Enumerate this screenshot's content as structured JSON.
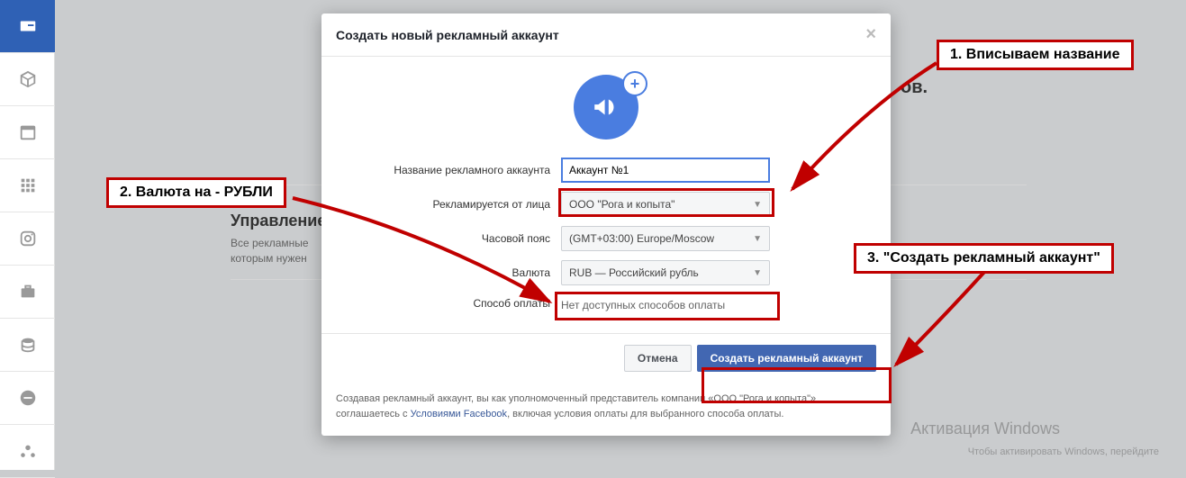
{
  "sidebar": {
    "items": [
      {
        "name": "id-card-icon"
      },
      {
        "name": "cube-icon"
      },
      {
        "name": "calendar-icon"
      },
      {
        "name": "grid-icon"
      },
      {
        "name": "instagram-icon"
      },
      {
        "name": "briefcase-icon"
      },
      {
        "name": "stack-icon"
      },
      {
        "name": "minus-circle-icon"
      },
      {
        "name": "share-icon"
      }
    ]
  },
  "background": {
    "heading_end": "ов.",
    "section_title": "Управление",
    "section_text1": "Все рекламные",
    "section_text2": "которым нужен"
  },
  "modal": {
    "title": "Создать новый рекламный аккаунт",
    "fields": {
      "name_label": "Название рекламного аккаунта",
      "name_value": "Аккаунт №1",
      "advertiser_label": "Рекламируется от лица",
      "advertiser_value": "ООО \"Рога и копыта\"",
      "timezone_label": "Часовой пояс",
      "timezone_value": "(GMT+03:00) Europe/Moscow",
      "currency_label": "Валюта",
      "currency_value": "RUB — Российский рубль",
      "payment_label": "Способ оплаты",
      "payment_value": "Нет доступных способов оплаты"
    },
    "footer": {
      "cancel": "Отмена",
      "create": "Создать рекламный аккаунт"
    },
    "disclaimer_1": "Создавая рекламный аккаунт, вы как уполномоченный представитель компании «ООО \"Рога и копыта\"» соглашаетесь с ",
    "disclaimer_link": "Условиями Facebook",
    "disclaimer_2": ", включая условия оплаты для выбранного способа оплаты."
  },
  "callouts": {
    "c1": "1. Вписываем название",
    "c2": "2. Валюта на - РУБЛИ",
    "c3": "3. \"Создать рекламный аккаунт\""
  },
  "watermark": {
    "line1": "Активация Windows",
    "line2": "Чтобы активировать Windows, перейдите"
  }
}
